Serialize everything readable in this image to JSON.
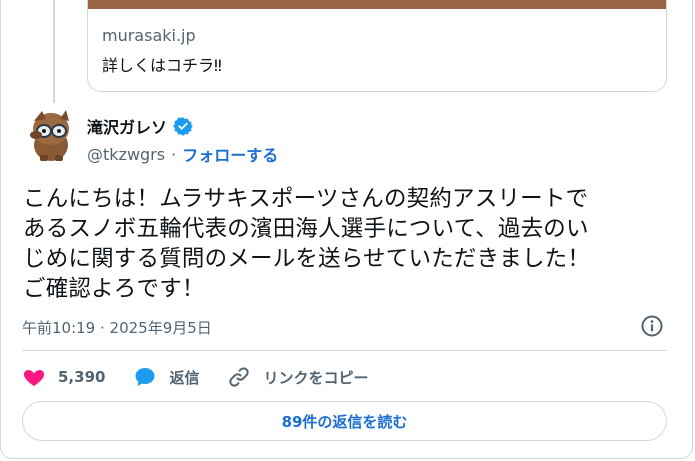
{
  "link_card": {
    "domain": "murasaki.jp",
    "title": "詳しくはコチラ‼"
  },
  "author": {
    "name": "滝沢ガレソ",
    "handle": "@tkzwgrs",
    "separator": "·",
    "follow_label": "フォローする",
    "verified": true
  },
  "tweet": {
    "text": "こんにちは！ムラサキスポーツさんの契約アスリートで\nあるスノボ五輪代表の濱田海人選手について、過去のい\nじめに関する質問のメールを送らせていただきました！\nご確認よろです！",
    "timestamp": "午前10:19 · 2025年9月5日"
  },
  "actions": {
    "like_count": "5,390",
    "reply_label": "返信",
    "copy_link_label": "リンクをコピー"
  },
  "replies_button": {
    "label": "89件の返信を読む"
  },
  "colors": {
    "accent": "#1a6fd0",
    "like": "#f91880",
    "reply_icon": "#1d9bf0",
    "verified": "#1d9bf0",
    "secondary_text": "#536471",
    "border": "#cfd9de"
  }
}
